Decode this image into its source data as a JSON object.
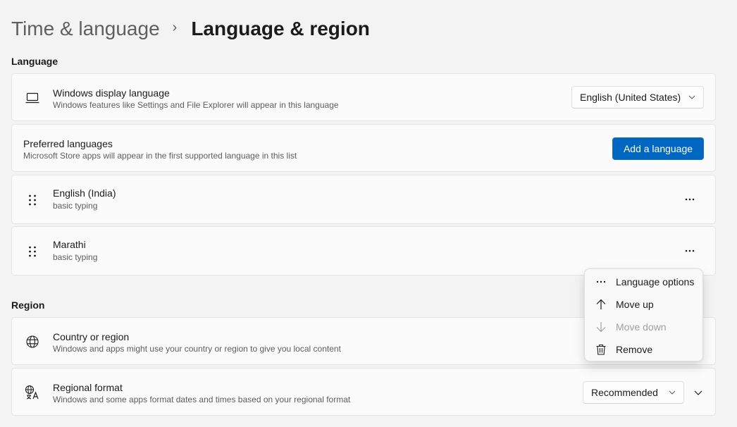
{
  "breadcrumb": {
    "parent": "Time & language",
    "separator": "›",
    "current": "Language & region"
  },
  "sections": {
    "language": "Language",
    "region": "Region"
  },
  "display_language": {
    "icon": "laptop-icon",
    "title": "Windows display language",
    "subtitle": "Windows features like Settings and File Explorer will appear in this language",
    "selected": "English (United States)"
  },
  "preferred_languages": {
    "title": "Preferred languages",
    "subtitle": "Microsoft Store apps will appear in the first supported language in this list",
    "add_button": "Add a language"
  },
  "languages": [
    {
      "name": "English (India)",
      "detail": "basic typing"
    },
    {
      "name": "Marathi",
      "detail": "basic typing"
    }
  ],
  "country_region": {
    "icon": "globe-icon",
    "title": "Country or region",
    "subtitle": "Windows and apps might use your country or region to give you local content"
  },
  "regional_format": {
    "icon": "language-format-icon",
    "title": "Regional format",
    "subtitle": "Windows and some apps format dates and times based on your regional format",
    "selected": "Recommended"
  },
  "context_menu": {
    "items": [
      {
        "label": "Language options",
        "icon": "more-horizontal-icon",
        "enabled": true
      },
      {
        "label": "Move up",
        "icon": "arrow-up-icon",
        "enabled": true
      },
      {
        "label": "Move down",
        "icon": "arrow-down-icon",
        "enabled": false
      },
      {
        "label": "Remove",
        "icon": "trash-icon",
        "enabled": true
      }
    ]
  },
  "colors": {
    "accent": "#0067c0",
    "background": "#f3f3f3",
    "card": "#fbfbfb"
  }
}
